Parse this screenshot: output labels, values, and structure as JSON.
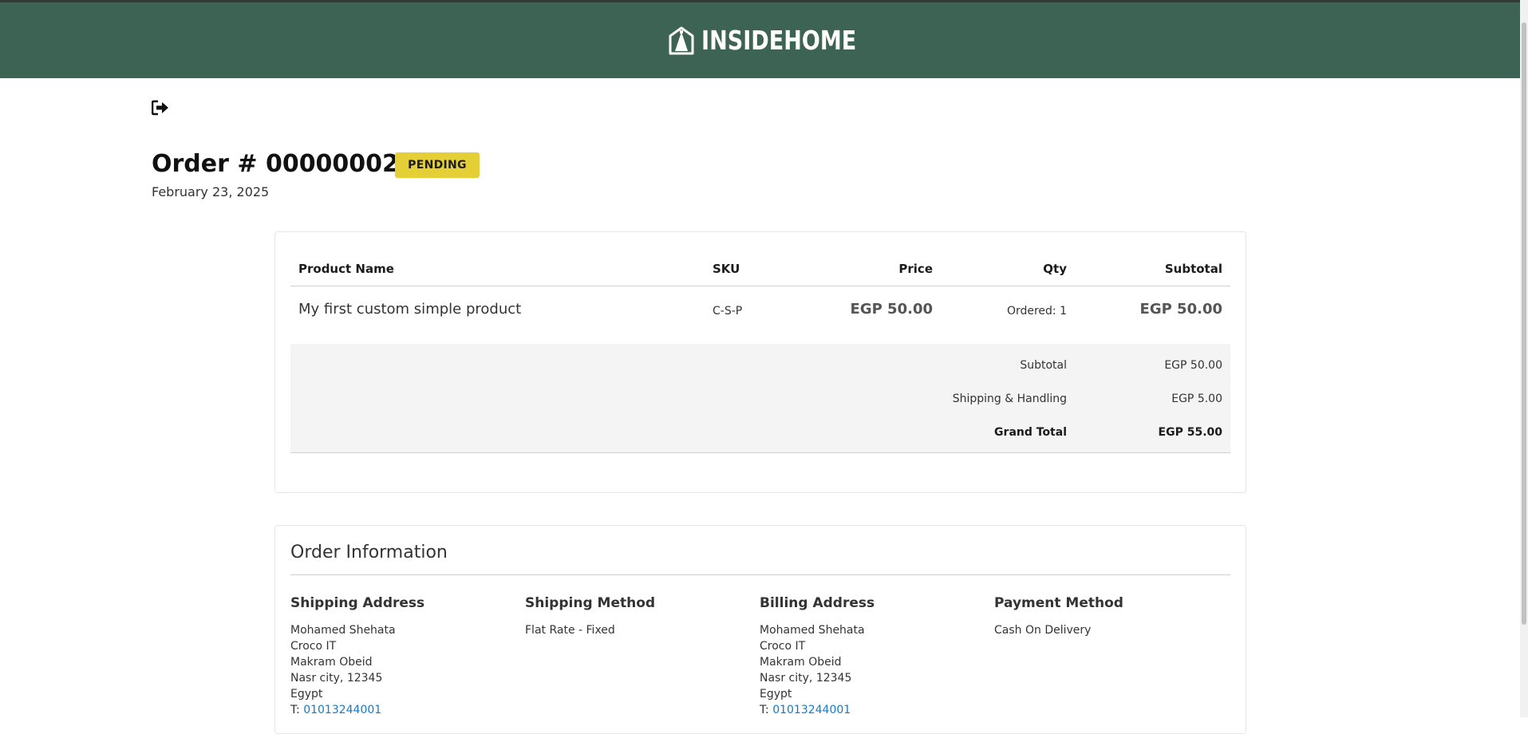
{
  "brand": {
    "name": "INSIDEHOME",
    "header_color": "#3d6354"
  },
  "toolbar": {
    "logout_icon": "sign-out-icon"
  },
  "order": {
    "title": "Order # 000000023",
    "status": "PENDING",
    "status_color": "#e5cf36",
    "date": "February 23, 2025"
  },
  "items_table": {
    "headers": {
      "name": "Product Name",
      "sku": "SKU",
      "price": "Price",
      "qty": "Qty",
      "subtotal": "Subtotal"
    },
    "rows": [
      {
        "name": "My first custom simple product",
        "sku": "C-S-P",
        "price": "EGP 50.00",
        "qty": "Ordered: 1",
        "subtotal": "EGP 50.00"
      }
    ]
  },
  "totals": {
    "subtotal": {
      "label": "Subtotal",
      "value": "EGP 50.00"
    },
    "shipping": {
      "label": "Shipping & Handling",
      "value": "EGP 5.00"
    },
    "grand_total": {
      "label": "Grand Total",
      "value": "EGP 55.00"
    }
  },
  "order_info": {
    "title": "Order Information",
    "shipping_address": {
      "heading": "Shipping Address",
      "name": "Mohamed Shehata",
      "company": "Croco IT",
      "street": "Makram Obeid",
      "city": "Nasr city, 12345",
      "country": "Egypt",
      "phone_prefix": "T: ",
      "phone": "01013244001"
    },
    "shipping_method": {
      "heading": "Shipping Method",
      "value": "Flat Rate - Fixed"
    },
    "billing_address": {
      "heading": "Billing Address",
      "name": "Mohamed Shehata",
      "company": "Croco IT",
      "street": "Makram Obeid",
      "city": "Nasr city, 12345",
      "country": "Egypt",
      "phone_prefix": "T: ",
      "phone": "01013244001"
    },
    "payment_method": {
      "heading": "Payment Method",
      "value": "Cash On Delivery"
    },
    "link_color": "#1979c3"
  }
}
